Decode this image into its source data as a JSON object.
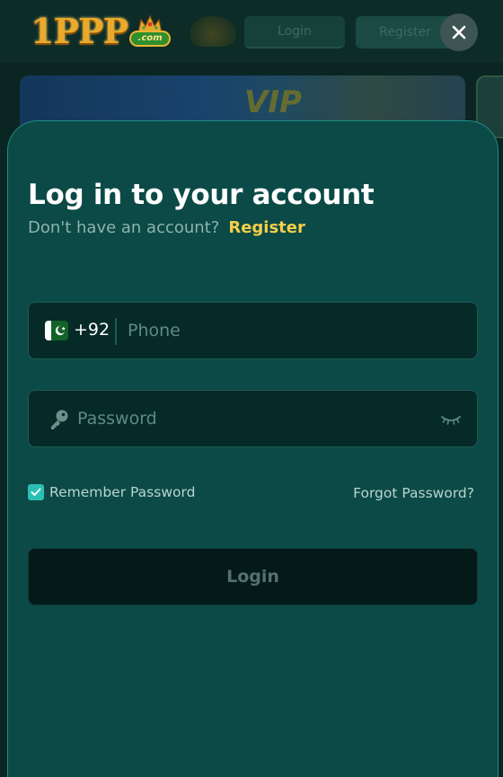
{
  "header": {
    "logo_text": "1PPP",
    "logo_suffix": ".com",
    "login_label": "Login",
    "register_label": "Register"
  },
  "banner": {
    "text": "",
    "vip": "VIP"
  },
  "modal": {
    "title": "Log in to your account",
    "no_account_text": "Don't have an account?",
    "register_link": "Register",
    "phone": {
      "country_code": "+92",
      "placeholder": "Phone",
      "flag": "pakistan-flag-icon"
    },
    "password": {
      "placeholder": "Password",
      "icon": "key-icon",
      "toggle_icon": "eye-closed-icon"
    },
    "remember_label": "Remember Password",
    "remember_checked": true,
    "forgot_label": "Forgot Password?",
    "login_label": "Login"
  },
  "colors": {
    "sheet_bg": "#0b4a46",
    "field_bg": "#052a28",
    "accent_link": "#f4cf4a",
    "checkbox": "#2bbfb3",
    "button_bg": "#041a18"
  }
}
